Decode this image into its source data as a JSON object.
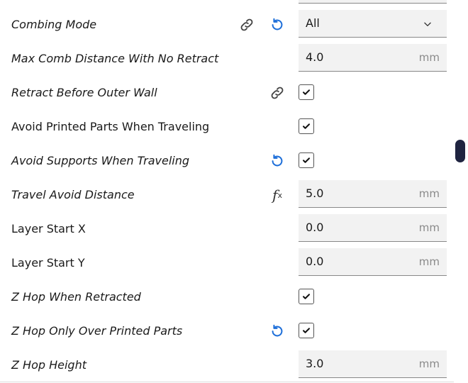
{
  "settings": [
    {
      "id": "combing-mode",
      "label": "Combing Mode",
      "italic": true,
      "control": "select",
      "value": "All",
      "link": true,
      "reset": true
    },
    {
      "id": "max-comb-distance",
      "label": "Max Comb Distance With No Retract",
      "italic": true,
      "control": "number",
      "value": "4.0",
      "unit": "mm"
    },
    {
      "id": "retract-before-outer-wall",
      "label": "Retract Before Outer Wall",
      "italic": true,
      "control": "checkbox",
      "checked": true,
      "link": true
    },
    {
      "id": "avoid-printed-parts",
      "label": "Avoid Printed Parts When Traveling",
      "italic": false,
      "control": "checkbox",
      "checked": true
    },
    {
      "id": "avoid-supports",
      "label": "Avoid Supports When Traveling",
      "italic": true,
      "control": "checkbox",
      "checked": true,
      "reset": true
    },
    {
      "id": "travel-avoid-distance",
      "label": "Travel Avoid Distance",
      "italic": true,
      "control": "number",
      "value": "5.0",
      "unit": "mm",
      "fx": true
    },
    {
      "id": "layer-start-x",
      "label": "Layer Start X",
      "italic": false,
      "control": "number",
      "value": "0.0",
      "unit": "mm"
    },
    {
      "id": "layer-start-y",
      "label": "Layer Start Y",
      "italic": false,
      "control": "number",
      "value": "0.0",
      "unit": "mm"
    },
    {
      "id": "z-hop-when-retracted",
      "label": "Z Hop When Retracted",
      "italic": true,
      "control": "checkbox",
      "checked": true
    },
    {
      "id": "z-hop-only-over-printed",
      "label": "Z Hop Only Over Printed Parts",
      "italic": true,
      "control": "checkbox",
      "checked": true,
      "reset": true
    },
    {
      "id": "z-hop-height",
      "label": "Z Hop Height",
      "italic": true,
      "control": "number",
      "value": "3.0",
      "unit": "mm"
    }
  ],
  "colors": {
    "reset_icon": "#1e6fd9",
    "link_icon": "#444444",
    "field_bg": "#f2f2f2",
    "scroll_thumb": "#1f2440"
  },
  "icons": {
    "link": "link-icon",
    "reset": "reset-icon",
    "fx": "function-icon",
    "check": "checkmark-icon",
    "chevron": "chevron-down-icon"
  },
  "fx_glyph": "f",
  "fx_sub": "x"
}
